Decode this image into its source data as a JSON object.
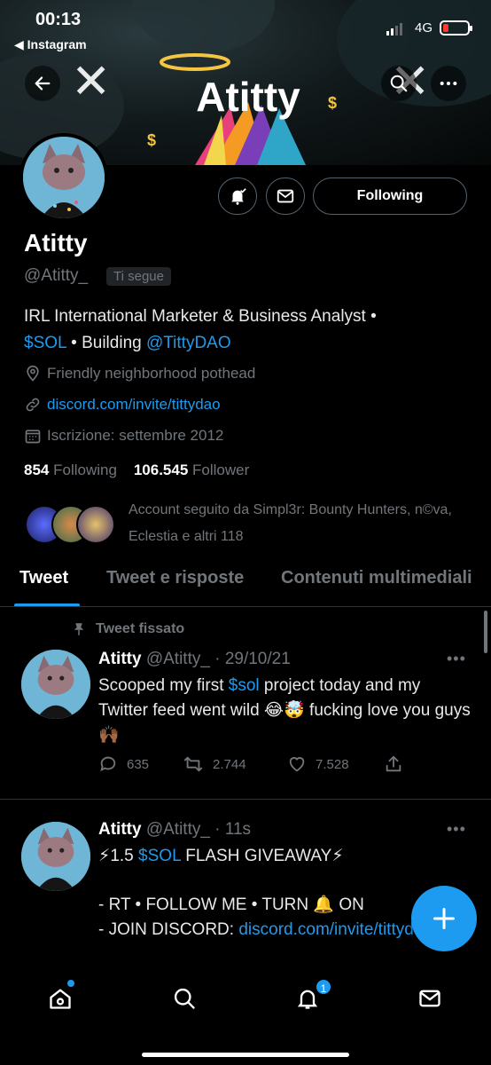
{
  "status": {
    "time": "00:13",
    "back_app": "◀ Instagram",
    "network": "4G"
  },
  "banner": {
    "art_text": "Atitty"
  },
  "profile": {
    "following_button": "Following",
    "name": "Atitty",
    "handle": "@Atitty_",
    "follows_you": "Ti segue",
    "bio_line1": "IRL International Marketer & Business Analyst •",
    "bio_token": "$SOL",
    "bio_sep": " • Building ",
    "bio_link": "@TittyDAO",
    "location": "Friendly neighborhood pothead",
    "website": "discord.com/invite/tittydao",
    "joined": "Iscrizione: settembre 2012",
    "following_count": "854",
    "following_label": "Following",
    "followers_count": "106.545",
    "followers_label": "Follower",
    "mutual_text": "Account seguito da Simpl3r: Bounty Hunters, n©va, Eclestia e altri 118"
  },
  "tabs": [
    "Tweet",
    "Tweet e risposte",
    "Contenuti multimediali"
  ],
  "tweets": [
    {
      "pinned_label": "Tweet fissato",
      "name": "Atitty",
      "meta": "@Atitty_ · 29/10/21",
      "text_a": "Scooped my first ",
      "text_token": "$sol",
      "text_b": " project today and my Twitter feed went wild 😂🤯 fucking love you guys 🙌🏾",
      "replies": "635",
      "retweets": "2.744",
      "likes": "7.528"
    },
    {
      "name": "Atitty",
      "meta": "@Atitty_ · 11s",
      "line1_a": "⚡1.5 ",
      "line1_token": "$SOL",
      "line1_b": " FLASH GIVEAWAY⚡",
      "line2": "- RT • FOLLOW ME • TURN 🔔 ON",
      "line3_a": "- JOIN DISCORD: ",
      "line3_link": "discord.com/invite/tittydao"
    }
  ],
  "notifications_badge": "1",
  "colors": {
    "accent": "#1d9bf0",
    "background": "#000000",
    "muted": "#71767b"
  }
}
